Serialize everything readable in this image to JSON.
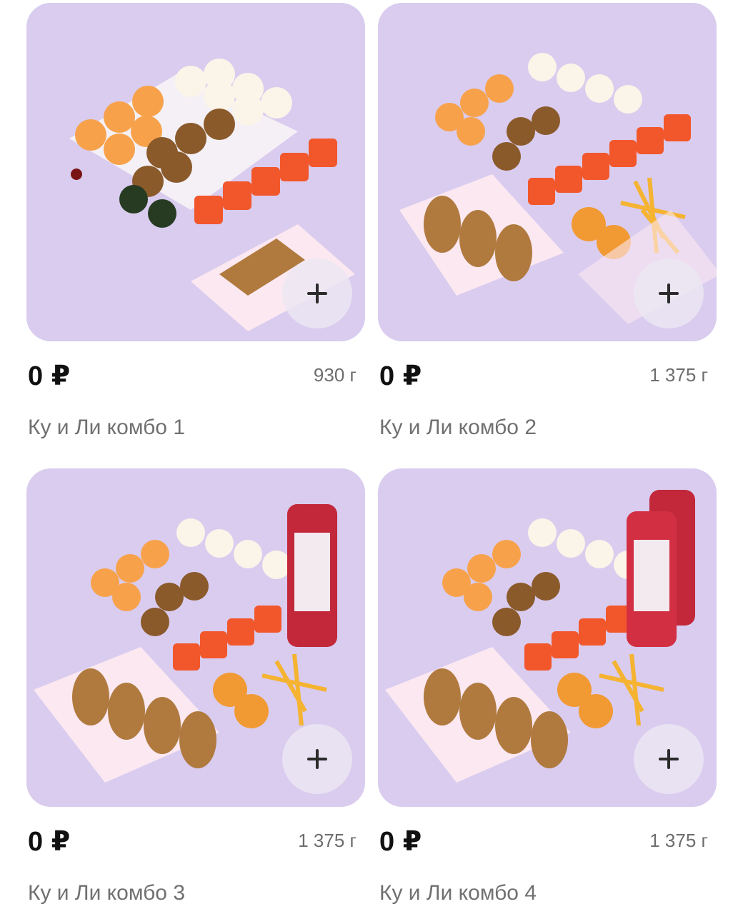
{
  "currency_symbol": "₽",
  "accent_colors": {
    "card_background": "#d9ccef",
    "add_button_background": "#ece8f2",
    "price_text": "#111111",
    "secondary_text": "#707070"
  },
  "products": [
    {
      "price": "0 ₽",
      "weight": "930 г",
      "name": "Ку и Ли комбо 1",
      "add_icon": "plus-icon"
    },
    {
      "price": "0 ₽",
      "weight": "1 375 г",
      "name": "Ку и Ли комбо 2",
      "add_icon": "plus-icon"
    },
    {
      "price": "0 ₽",
      "weight": "1 375 г",
      "name": "Ку и Ли комбо 3",
      "add_icon": "plus-icon"
    },
    {
      "price": "0 ₽",
      "weight": "1 375 г",
      "name": "Ку и Ли комбо 4",
      "add_icon": "plus-icon"
    }
  ]
}
